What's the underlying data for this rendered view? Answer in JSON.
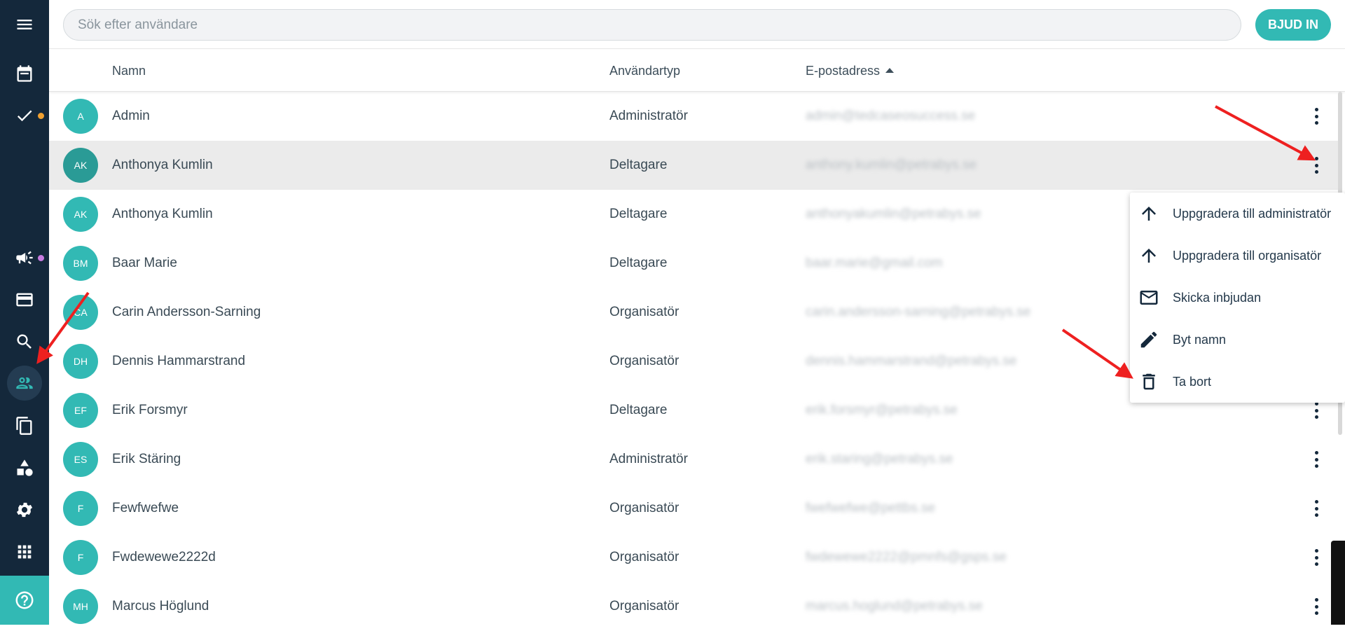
{
  "search": {
    "placeholder": "Sök efter användare"
  },
  "invite_button": "BJUD IN",
  "table": {
    "headers": {
      "name": "Namn",
      "user_type": "Användartyp",
      "email": "E-postadress"
    },
    "rows": [
      {
        "initials": "A",
        "name": "Admin",
        "type": "Administratör",
        "email": "admin@tedcaseosuccess.se"
      },
      {
        "initials": "AK",
        "name": "Anthonya Kumlin",
        "type": "Deltagare",
        "email": "anthony.kumlin@petrabys.se"
      },
      {
        "initials": "AK",
        "name": "Anthonya Kumlin",
        "type": "Deltagare",
        "email": "anthonyakumlin@petrabys.se"
      },
      {
        "initials": "BM",
        "name": "Baar Marie",
        "type": "Deltagare",
        "email": "baar.marie@gmail.com"
      },
      {
        "initials": "CA",
        "name": "Carin Andersson-Sarning",
        "type": "Organisatör",
        "email": "carin.andersson-sarning@petrabys.se"
      },
      {
        "initials": "DH",
        "name": "Dennis Hammarstrand",
        "type": "Organisatör",
        "email": "dennis.hammarstrand@petrabys.se"
      },
      {
        "initials": "EF",
        "name": "Erik Forsmyr",
        "type": "Deltagare",
        "email": "erik.forsmyr@petrabys.se"
      },
      {
        "initials": "ES",
        "name": "Erik Stäring",
        "type": "Administratör",
        "email": "erik.staring@petrabys.se"
      },
      {
        "initials": "F",
        "name": "Fewfwefwe",
        "type": "Organisatör",
        "email": "fwefwefwe@pettbs.se"
      },
      {
        "initials": "F",
        "name": "Fwdewewe2222d",
        "type": "Organisatör",
        "email": "fwdewewe2222@pmnfs@gsps.se"
      },
      {
        "initials": "MH",
        "name": "Marcus Höglund",
        "type": "Organisatör",
        "email": "marcus.hoglund@petrabys.se"
      }
    ]
  },
  "context_menu": {
    "items": [
      {
        "label": "Uppgradera till administratör",
        "icon": "arrow-up-icon"
      },
      {
        "label": "Uppgradera till organisatör",
        "icon": "arrow-up-icon"
      },
      {
        "label": "Skicka inbjudan",
        "icon": "mail-icon"
      },
      {
        "label": "Byt namn",
        "icon": "pencil-icon"
      },
      {
        "label": "Ta bort",
        "icon": "trash-icon"
      }
    ]
  },
  "colors": {
    "sidebar": "#14283b",
    "accent": "#32b9b4",
    "orange_dot": "#f0a030",
    "pink_dot": "#c77be0",
    "annotation_arrow": "#ee2020"
  }
}
